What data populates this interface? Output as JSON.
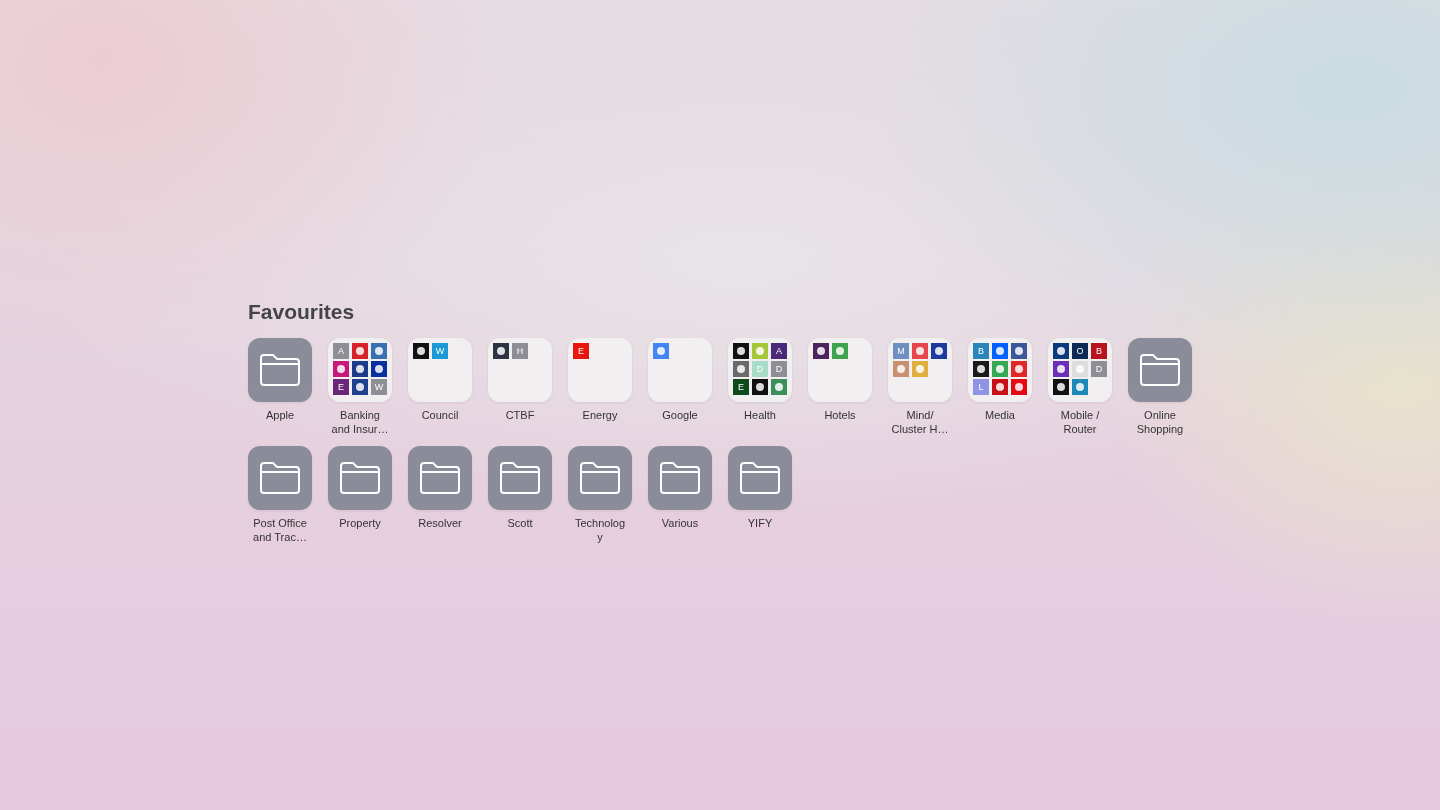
{
  "section": {
    "title": "Favourites"
  },
  "favourites": [
    {
      "kind": "folder",
      "label": "Apple"
    },
    {
      "kind": "group",
      "label": "Banking\nand Insur…",
      "icons": [
        {
          "text": "A",
          "color": "#8e8e96"
        },
        {
          "color": "#d8232a"
        },
        {
          "color": "#3a6fb0"
        },
        {
          "color": "#c8187a"
        },
        {
          "color": "#1b3d8a"
        },
        {
          "color": "#0a2f9e"
        },
        {
          "text": "E",
          "color": "#6a2777"
        },
        {
          "color": "#1f3f8f"
        },
        {
          "text": "W",
          "color": "#8e8e96"
        }
      ]
    },
    {
      "kind": "group",
      "label": "Council",
      "icons": [
        {
          "color": "#111111"
        },
        {
          "text": "W",
          "color": "#1b9ad6"
        }
      ]
    },
    {
      "kind": "group",
      "label": "CTBF",
      "icons": [
        {
          "color": "#2b3440"
        },
        {
          "text": "H",
          "color": "#8e8e96"
        }
      ]
    },
    {
      "kind": "group",
      "label": "Energy",
      "icons": [
        {
          "text": "E",
          "color": "#e8160c"
        }
      ]
    },
    {
      "kind": "group",
      "label": "Google",
      "icons": [
        {
          "color": "#4285f4"
        }
      ]
    },
    {
      "kind": "group",
      "label": "Health",
      "icons": [
        {
          "color": "#111111"
        },
        {
          "color": "#a5c83a"
        },
        {
          "text": "A",
          "color": "#4b2a7a"
        },
        {
          "color": "#6a6a6a"
        },
        {
          "text": "D",
          "color": "#a8dcc8"
        },
        {
          "text": "D",
          "color": "#8e8e96"
        },
        {
          "text": "E",
          "color": "#0d4a1c"
        },
        {
          "color": "#111111"
        },
        {
          "color": "#3d8f5a"
        }
      ]
    },
    {
      "kind": "group",
      "label": "Hotels",
      "icons": [
        {
          "color": "#4b2460"
        },
        {
          "color": "#3fa34d"
        }
      ]
    },
    {
      "kind": "group",
      "label": "Mind/\nCluster H…",
      "icons": [
        {
          "text": "M",
          "color": "#6e8fc0"
        },
        {
          "color": "#e5474b"
        },
        {
          "color": "#1e3a9e"
        },
        {
          "color": "#c89070"
        },
        {
          "color": "#e0b040"
        }
      ]
    },
    {
      "kind": "group",
      "label": "Media",
      "icons": [
        {
          "text": "B",
          "color": "#2a86b8"
        },
        {
          "color": "#0061fe"
        },
        {
          "color": "#3b5998"
        },
        {
          "color": "#1a1a1a"
        },
        {
          "color": "#34a853"
        },
        {
          "color": "#e12828"
        },
        {
          "text": "L",
          "color": "#8f93e6"
        },
        {
          "color": "#c81018"
        },
        {
          "color": "#e50914"
        }
      ]
    },
    {
      "kind": "group",
      "label": "Mobile /\nRouter",
      "icons": [
        {
          "color": "#0a3a7a"
        },
        {
          "text": "O",
          "color": "#0b2a55"
        },
        {
          "text": "B",
          "color": "#b8141e"
        },
        {
          "color": "#6b2fb8"
        },
        {
          "color": "#dddddd"
        },
        {
          "text": "D",
          "color": "#8e8e96"
        },
        {
          "color": "#111111"
        },
        {
          "color": "#1e88b8"
        }
      ]
    },
    {
      "kind": "folder",
      "label": "Online\nShopping"
    },
    {
      "kind": "folder",
      "label": "Post Office\nand Trac…"
    },
    {
      "kind": "folder",
      "label": "Property"
    },
    {
      "kind": "folder",
      "label": "Resolver"
    },
    {
      "kind": "folder",
      "label": "Scott"
    },
    {
      "kind": "folder",
      "label": "Technolog\ny"
    },
    {
      "kind": "folder",
      "label": "Various"
    },
    {
      "kind": "folder",
      "label": "YIFY"
    }
  ]
}
